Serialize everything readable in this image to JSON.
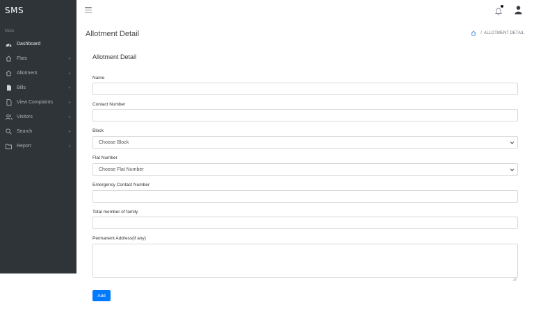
{
  "brand": "SMS",
  "sidebar": {
    "section_title": "Main",
    "items": [
      {
        "label": "Dashboard",
        "icon": "dashboard-icon",
        "has_plus": false
      },
      {
        "label": "Flats",
        "icon": "home-icon",
        "has_plus": true
      },
      {
        "label": "Allotment",
        "icon": "home-icon",
        "has_plus": true
      },
      {
        "label": "Bills",
        "icon": "document-icon",
        "has_plus": true
      },
      {
        "label": "View Complaints",
        "icon": "file-icon",
        "has_plus": true
      },
      {
        "label": "Visitors",
        "icon": "users-icon",
        "has_plus": true
      },
      {
        "label": "Search",
        "icon": "search-icon",
        "has_plus": true
      },
      {
        "label": "Report",
        "icon": "folder-icon",
        "has_plus": true
      }
    ],
    "plus_glyph": "+"
  },
  "page": {
    "title": "Allotment Detail",
    "breadcrumb_sep": "/",
    "breadcrumb_current": "ALLOTMENT DETAIL"
  },
  "form": {
    "title": "Allotment Detail",
    "name_label": "Name",
    "name_value": "",
    "contact_label": "Contact Number",
    "contact_value": "",
    "block_label": "Block",
    "block_selected": "Choose Block",
    "flat_label": "Flat Number",
    "flat_selected": "Choose Flat Number",
    "emergency_label": "Emergency Contact Number",
    "emergency_value": "",
    "family_label": "Total member of family",
    "family_value": "",
    "address_label": "Permanent Address(if any)",
    "address_value": "",
    "submit_label": "Add"
  },
  "colors": {
    "sidebar_bg": "#2f3438",
    "primary": "#007bff",
    "breadcrumb_home": "#4a90e2"
  }
}
